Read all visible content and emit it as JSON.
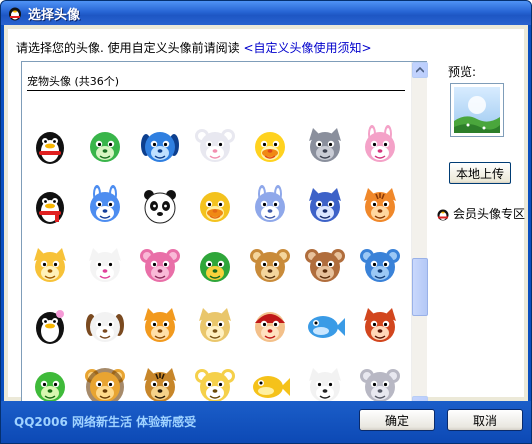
{
  "window": {
    "title": "选择头像"
  },
  "instruction": {
    "text": "请选择您的头像. 使用自定义头像前请阅读 ",
    "link": "<自定义头像使用须知>"
  },
  "preview": {
    "label": "预览:"
  },
  "upload_button": {
    "label": "本地上传"
  },
  "vip_link": {
    "label": "会员头像专区"
  },
  "avatar_list": {
    "category": "宠物头像 (共36个)",
    "avatars": [
      {
        "name": "penguin-red-scarf",
        "bg": "#ffffff",
        "icon": "penguin"
      },
      {
        "name": "green-dinosaur",
        "bg": "#ffffff",
        "icon": "dino"
      },
      {
        "name": "blue-dog",
        "bg": "#ffffff",
        "icon": "dog-blue"
      },
      {
        "name": "white-mouse",
        "bg": "#ffffff",
        "icon": "mouse"
      },
      {
        "name": "yellow-chick",
        "bg": "#ffffff",
        "icon": "chick"
      },
      {
        "name": "gray-cat",
        "bg": "#ffffff",
        "icon": "cat-gray"
      },
      {
        "name": "pink-rabbit",
        "bg": "#ffffff",
        "icon": "rabbit-pink"
      },
      {
        "name": "penguin-bow",
        "bg": "#ffffff",
        "icon": "penguin2"
      },
      {
        "name": "blue-rabbit",
        "bg": "#ffffff",
        "icon": "rabbit-blue"
      },
      {
        "name": "panda",
        "bg": "#ffffff",
        "icon": "panda"
      },
      {
        "name": "yellow-duck",
        "bg": "#ffffff",
        "icon": "duck"
      },
      {
        "name": "blue-bunny",
        "bg": "#ffffff",
        "icon": "bunny"
      },
      {
        "name": "blue-wolf",
        "bg": "#ffffff",
        "icon": "wolf"
      },
      {
        "name": "orange-tiger",
        "bg": "#ffffff",
        "icon": "tiger"
      },
      {
        "name": "yellow-cat",
        "bg": "#ffffff",
        "icon": "cat-yellow"
      },
      {
        "name": "white-cat",
        "bg": "#ffffff",
        "icon": "cat-white"
      },
      {
        "name": "pink-elephant",
        "bg": "#ffffff",
        "icon": "elephant"
      },
      {
        "name": "green-duck",
        "bg": "#ffffff",
        "icon": "duck-green"
      },
      {
        "name": "brown-bear",
        "bg": "#ffffff",
        "icon": "bear"
      },
      {
        "name": "walrus",
        "bg": "#ffffff",
        "icon": "walrus"
      },
      {
        "name": "blue-hippo",
        "bg": "#ffffff",
        "icon": "hippo"
      },
      {
        "name": "penguin-flower",
        "bg": "#ffffff",
        "icon": "penguin3"
      },
      {
        "name": "beagle",
        "bg": "#ffffff",
        "icon": "beagle"
      },
      {
        "name": "orange-squirrel",
        "bg": "#ffffff",
        "icon": "squirrel"
      },
      {
        "name": "cheetah",
        "bg": "#ffffff",
        "icon": "cheetah"
      },
      {
        "name": "cartoon-boy",
        "bg": "#ffffff",
        "icon": "boy"
      },
      {
        "name": "dolphin",
        "bg": "#ffffff",
        "icon": "dolphin"
      },
      {
        "name": "red-panda",
        "bg": "#ffffff",
        "icon": "redpanda"
      },
      {
        "name": "frog",
        "bg": "#ffffff",
        "icon": "frog"
      },
      {
        "name": "lion",
        "bg": "#ffffff",
        "icon": "lion"
      },
      {
        "name": "tiger-stripes",
        "bg": "#ffffff",
        "icon": "tiger2"
      },
      {
        "name": "cow",
        "bg": "#ffffff",
        "icon": "cow"
      },
      {
        "name": "yellow-fish",
        "bg": "#ffffff",
        "icon": "fish"
      },
      {
        "name": "badger",
        "bg": "#ffffff",
        "icon": "badger"
      },
      {
        "name": "gray-mouse",
        "bg": "#ffffff",
        "icon": "mouse-gray"
      }
    ]
  },
  "footer": {
    "slogan": "QQ2006  网络新生活  体验新感受",
    "ok_label": "确定",
    "cancel_label": "取消"
  }
}
